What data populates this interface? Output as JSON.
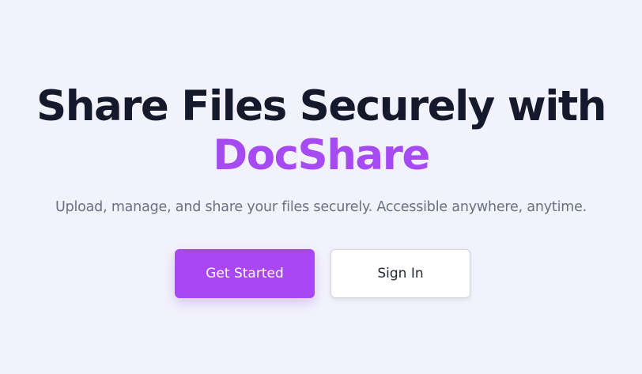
{
  "hero": {
    "headline_line1": "Share Files Securely with",
    "headline_brand": "DocShare",
    "subtitle": "Upload, manage, and share your files securely. Accessible anywhere, anytime."
  },
  "actions": {
    "primary_label": "Get Started",
    "secondary_label": "Sign In"
  },
  "colors": {
    "background": "#f2f2fc",
    "headline": "#141a2b",
    "brand_accent": "#a64bf3",
    "subtitle": "#697180",
    "primary_button": "#aa47f5",
    "secondary_button": "#ffffff"
  }
}
